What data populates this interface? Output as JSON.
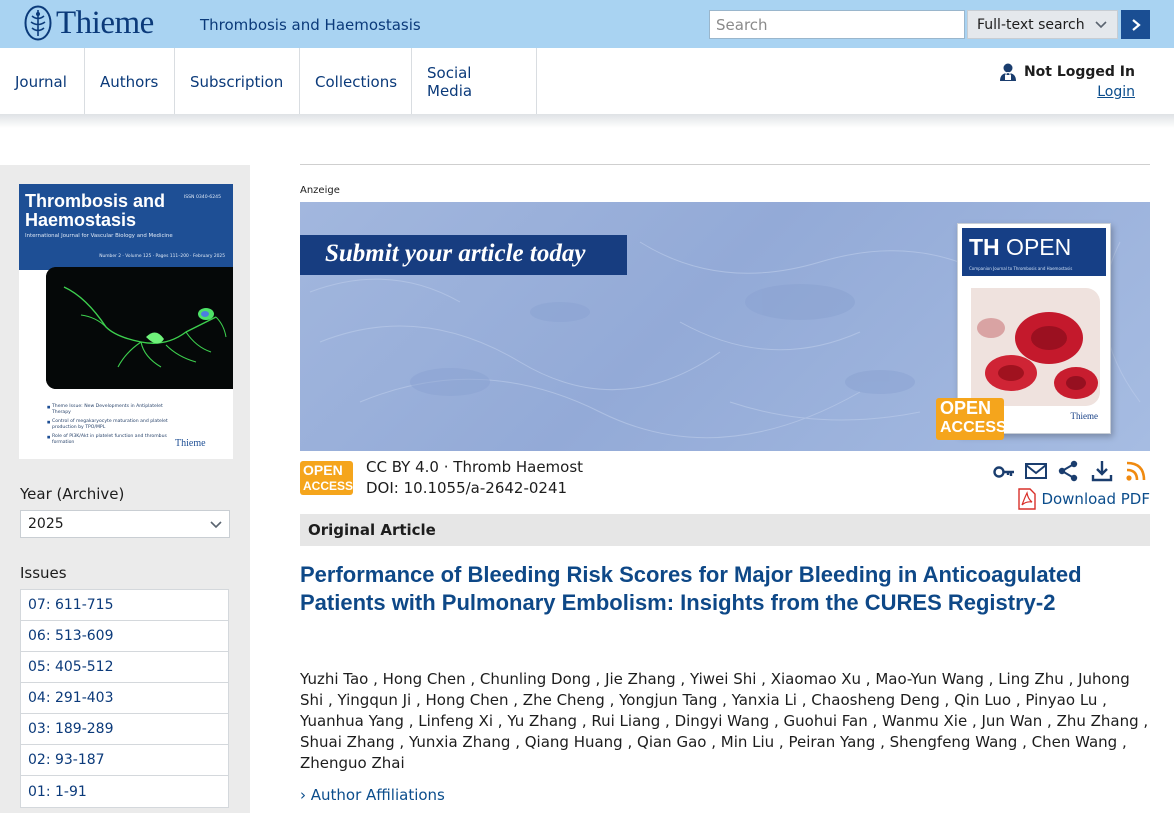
{
  "brand": {
    "name": "Thieme",
    "journal": "Thrombosis and Haemostasis"
  },
  "search": {
    "placeholder": "Search",
    "scope": "Full-text search"
  },
  "nav": {
    "items": [
      {
        "label": "Journal"
      },
      {
        "label": "Authors"
      },
      {
        "label": "Subscription"
      },
      {
        "label": "Collections"
      },
      {
        "label": "Social Media"
      }
    ],
    "status": "Not Logged In",
    "login": "Login"
  },
  "cover": {
    "title": "Thrombosis and Haemostasis",
    "subtitle": "International Journal for Vascular Biology and Medicine",
    "issn": "ISSN 0340-6245",
    "volume": "Number 2 · Volume 125 · Pages 111–200 · February 2025",
    "bullets": [
      "Theme Issue: New Developments in Antiplatelet Therapy",
      "Control of megakaryocyte maturation and platelet production by TPO/MPL",
      "Role of PI3K/Akt in platelet function and thrombus formation"
    ],
    "brand": "Thieme"
  },
  "sidebar": {
    "year_label": "Year (Archive)",
    "year_value": "2025",
    "issues_label": "Issues",
    "issues": [
      "07: 611-715",
      "06: 513-609",
      "05: 405-512",
      "04: 291-403",
      "03: 189-289",
      "02: 93-187",
      "01: 1-91"
    ]
  },
  "ad": {
    "label": "Anzeige",
    "headline": "Submit your article today",
    "card_title_bold": "TH",
    "card_title": " OPEN",
    "card_tagline": "Companion Journal to Thrombosis and Haemostasis",
    "card_brand": "Thieme",
    "badge_line1": "OPEN",
    "badge_line2": "ACCESS"
  },
  "article": {
    "badge_line1": "OPEN",
    "badge_line2": "ACCESS",
    "license": "CC BY 4.0 · Thromb Haemost",
    "doi": "DOI: 10.1055/a-2642-0241",
    "tools": [
      "link-icon",
      "mail-icon",
      "share-icon",
      "download-icon",
      "rss-icon"
    ],
    "download_pdf": "Download PDF",
    "type": "Original Article",
    "title": "Performance of Bleeding Risk Scores for Major Bleeding in Anticoagulated Patients with Pulmonary Embolism: Insights from the CURES Registry-2",
    "authors": "Yuzhi Tao , Hong Chen , Chunling Dong , Jie Zhang , Yiwei Shi , Xiaomao Xu , Mao-Yun Wang , Ling Zhu , Juhong Shi , Yingqun Ji , Hong Chen , Zhe Cheng , Yongjun Tang , Yanxia Li , Chaosheng Deng , Qin Luo , Pinyao Lu , Yuanhua Yang , Linfeng Xi , Yu Zhang , Rui Liang , Dingyi Wang , Guohui Fan , Wanmu Xie , Jun Wan , Zhu Zhang , Shuai Zhang , Yunxia Zhang , Qiang Huang , Qian Gao , Min Liu , Peiran Yang , Shengfeng Wang , Chen Wang , Zhenguo Zhai",
    "affiliations": "› Author Affiliations"
  },
  "colors": {
    "brand_blue": "#0b3a7a",
    "topbar": "#a9d3f2",
    "open_access": "#f5a51c",
    "title_blue": "#0e4887"
  }
}
